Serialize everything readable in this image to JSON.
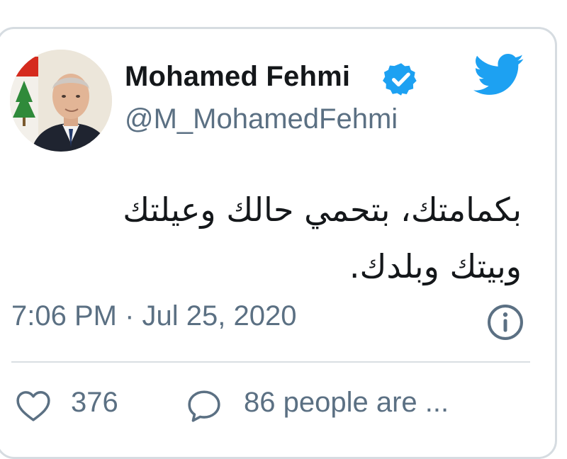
{
  "tweet": {
    "author": {
      "display_name": "Mohamed Fehmi",
      "handle": "@M_MohamedFehmi",
      "verified": true,
      "avatar_icon": "profile-photo"
    },
    "text_lines": [
      "بكمامتك، بتحمي حالك وعيلتك",
      "وبيتك وبلدك."
    ],
    "timestamp": "7:06 PM · Jul 25, 2020",
    "actions": {
      "like_count": "376",
      "reply_text": "86 people are ..."
    }
  },
  "icons": {
    "brand": "twitter-bird-icon",
    "verified": "verified-badge-icon",
    "info": "info-icon",
    "like": "heart-icon",
    "reply": "speech-bubble-icon"
  },
  "colors": {
    "twitter_blue": "#1da1f2",
    "text_primary": "#14171a",
    "text_secondary": "#5b7083",
    "border": "#d6dce1"
  }
}
